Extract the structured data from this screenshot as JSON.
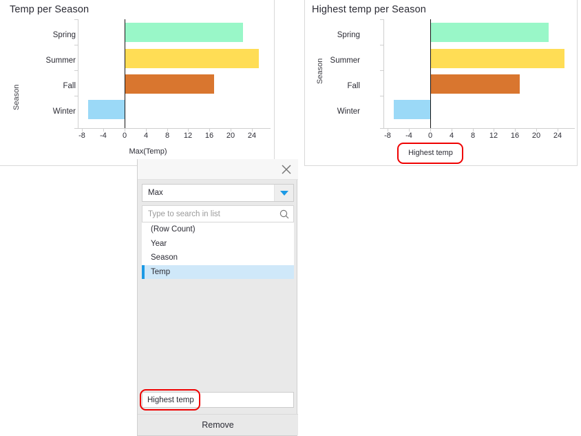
{
  "charts": [
    {
      "id": "left",
      "title": "Temp per Season",
      "ylabel": "Season",
      "xlabel": "Max(Temp)",
      "xlabel_highlighted": false
    },
    {
      "id": "right",
      "title": "Highest temp per Season",
      "ylabel": "Season",
      "xlabel": "Highest temp",
      "xlabel_highlighted": true
    }
  ],
  "chart_data": [
    {
      "type": "bar",
      "orientation": "horizontal",
      "title": "Temp per Season",
      "xlabel": "Max(Temp)",
      "ylabel": "Season",
      "categories": [
        "Spring",
        "Summer",
        "Fall",
        "Winter"
      ],
      "values": [
        22.3,
        25.3,
        16.8,
        -6.9
      ],
      "colors": [
        "#99f7c8",
        "#ffdd55",
        "#d9762f",
        "#9bd9f7"
      ],
      "xlim": [
        -9.5,
        26.5
      ],
      "xticks": [
        -8,
        -4,
        0,
        4,
        8,
        12,
        16,
        20,
        24
      ],
      "grid": false,
      "legend": "none"
    },
    {
      "type": "bar",
      "orientation": "horizontal",
      "title": "Highest temp per Season",
      "xlabel": "Highest temp",
      "ylabel": "Season",
      "categories": [
        "Spring",
        "Summer",
        "Fall",
        "Winter"
      ],
      "values": [
        22.3,
        25.3,
        16.8,
        -6.9
      ],
      "colors": [
        "#99f7c8",
        "#ffdd55",
        "#d9762f",
        "#9bd9f7"
      ],
      "xlim": [
        -9.5,
        26.5
      ],
      "xticks": [
        -8,
        -4,
        0,
        4,
        8,
        12,
        16,
        20,
        24
      ],
      "grid": false,
      "legend": "none"
    }
  ],
  "dialog": {
    "close_icon": "close-icon",
    "aggregation": {
      "value": "Max",
      "arrow_icon": "chevron-down-icon"
    },
    "search": {
      "placeholder": "Type to search in list",
      "value": "",
      "icon": "search-icon"
    },
    "list": {
      "items": [
        {
          "label": "(Row Count)",
          "selected": false
        },
        {
          "label": "Year",
          "selected": false
        },
        {
          "label": "Season",
          "selected": false
        },
        {
          "label": "Temp",
          "selected": true
        }
      ]
    },
    "name_field": {
      "value": "Highest temp",
      "highlighted": true
    },
    "remove_label": "Remove"
  },
  "accent": {
    "blue": "#1b9ae5",
    "selection": "#cfe8f9",
    "highlight_ring": "#ef0000"
  }
}
